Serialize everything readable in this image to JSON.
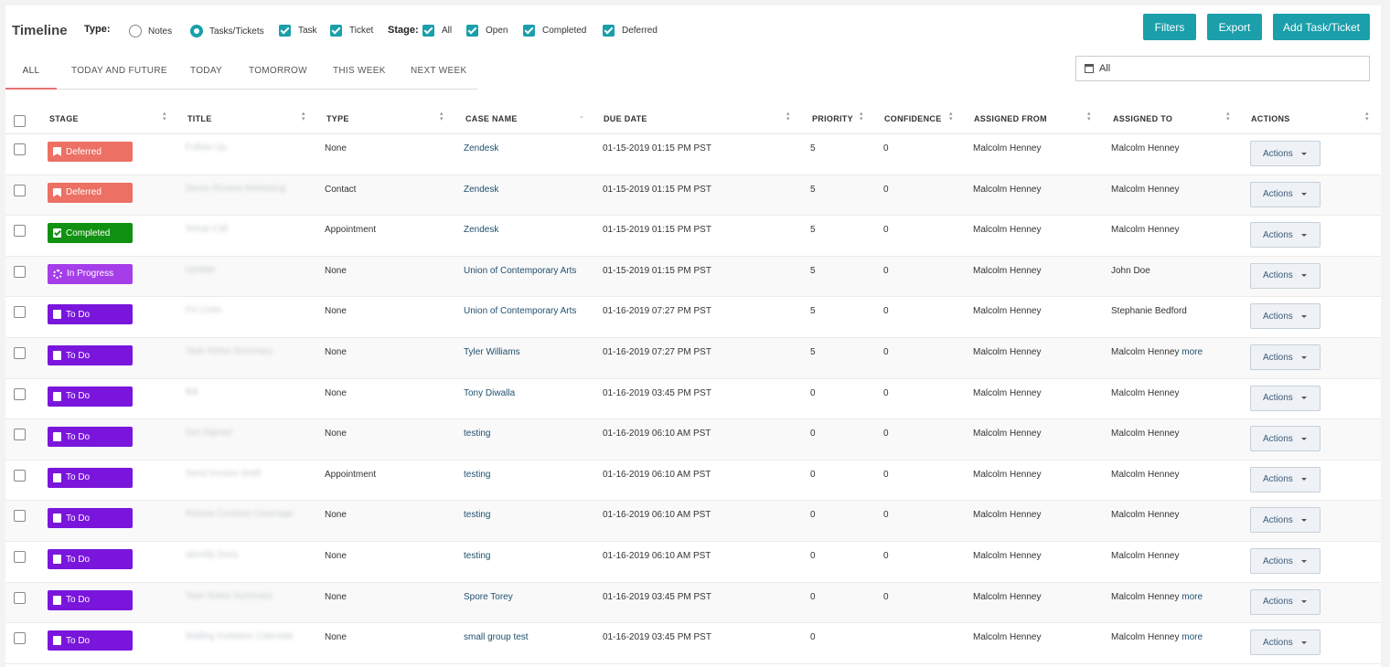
{
  "header": {
    "title": "Timeline",
    "type_label": "Type:",
    "stage_label": "Stage:",
    "type_options": [
      {
        "label": "Notes",
        "checked": false
      },
      {
        "label": "Tasks/Tickets",
        "checked": true
      }
    ],
    "type_checks": [
      {
        "label": "Task",
        "checked": true
      },
      {
        "label": "Ticket",
        "checked": true
      }
    ],
    "stage_checks": [
      {
        "label": "All",
        "checked": true
      },
      {
        "label": "Open",
        "checked": true
      },
      {
        "label": "Completed",
        "checked": true
      },
      {
        "label": "Deferred",
        "checked": true
      }
    ],
    "buttons": {
      "filters": "Filters",
      "export": "Export",
      "add": "Add Task/Ticket"
    },
    "accent_color": "#1a9fab"
  },
  "tabs": [
    {
      "label": "ALL",
      "active": true
    },
    {
      "label": "TODAY AND FUTURE",
      "active": false
    },
    {
      "label": "TODAY",
      "active": false
    },
    {
      "label": "TOMORROW",
      "active": false
    },
    {
      "label": "THIS WEEK",
      "active": false
    },
    {
      "label": "NEXT WEEK",
      "active": false
    }
  ],
  "date_filter": {
    "value": "All",
    "icon": "calendar-icon"
  },
  "table": {
    "columns": [
      "STAGE",
      "TITLE",
      "TYPE",
      "CASE NAME",
      "DUE DATE",
      "PRIORITY",
      "CONFIDENCE",
      "ASSIGNED FROM",
      "ASSIGNED TO",
      "ACTIONS"
    ],
    "stage_colors": {
      "Deferred": "#ec7063",
      "Completed": "#119111",
      "In Progress": "#a53ee8",
      "To Do": "#7a16dc"
    },
    "actions_label": "Actions",
    "more_label": "more",
    "rows": [
      {
        "stage": "Deferred",
        "title": "Follow Up",
        "type": "None",
        "case": "Zendesk",
        "due": "01-15-2019 01:15 PM PST",
        "priority": "5",
        "confidence": "0",
        "from": "Malcolm  Henney",
        "to": "Malcolm  Henney",
        "more": false
      },
      {
        "stage": "Deferred",
        "title": "Demo Review Marketing",
        "type": "Contact",
        "case": "Zendesk",
        "due": "01-15-2019 01:15 PM PST",
        "priority": "5",
        "confidence": "0",
        "from": "Malcolm  Henney",
        "to": "Malcolm  Henney",
        "more": false
      },
      {
        "stage": "Completed",
        "title": "Setup Call",
        "type": "Appointment",
        "case": "Zendesk",
        "due": "01-15-2019 01:15 PM PST",
        "priority": "5",
        "confidence": "0",
        "from": "Malcolm  Henney",
        "to": "Malcolm  Henney",
        "more": false
      },
      {
        "stage": "In Progress",
        "title": "Update",
        "type": "None",
        "case": "Union of Contemporary Arts",
        "due": "01-15-2019 01:15 PM PST",
        "priority": "5",
        "confidence": "0",
        "from": "Malcolm  Henney",
        "to": "John  Doe",
        "more": false
      },
      {
        "stage": "To Do",
        "title": "Fix Links",
        "type": "None",
        "case": "Union of Contemporary Arts",
        "due": "01-16-2019 07:27 PM PST",
        "priority": "5",
        "confidence": "0",
        "from": "Malcolm  Henney",
        "to": "Stephanie  Bedford",
        "more": false
      },
      {
        "stage": "To Do",
        "title": "Task Notes Summary",
        "type": "None",
        "case": "Tyler Williams",
        "due": "01-16-2019 07:27 PM PST",
        "priority": "5",
        "confidence": "0",
        "from": "Malcolm  Henney",
        "to": "Malcolm  Henney",
        "more": true
      },
      {
        "stage": "To Do",
        "title": "Bill",
        "type": "None",
        "case": "Tony  Diwalla",
        "due": "01-16-2019 03:45 PM PST",
        "priority": "0",
        "confidence": "0",
        "from": "Malcolm  Henney",
        "to": "Malcolm  Henney",
        "more": false
      },
      {
        "stage": "To Do",
        "title": "Get Signed",
        "type": "None",
        "case": "testing",
        "due": "01-16-2019 06:10 AM PST",
        "priority": "0",
        "confidence": "0",
        "from": "Malcolm  Henney",
        "to": "Malcolm  Henney",
        "more": false
      },
      {
        "stage": "To Do",
        "title": "Send Invoice Draft",
        "type": "Appointment",
        "case": "testing",
        "due": "01-16-2019 06:10 AM PST",
        "priority": "0",
        "confidence": "0",
        "from": "Malcolm  Henney",
        "to": "Malcolm  Henney",
        "more": false
      },
      {
        "stage": "To Do",
        "title": "Renew Contract Coverage",
        "type": "None",
        "case": "testing",
        "due": "01-16-2019 06:10 AM PST",
        "priority": "0",
        "confidence": "0",
        "from": "Malcolm  Henney",
        "to": "Malcolm  Henney",
        "more": false
      },
      {
        "stage": "To Do",
        "title": "Identify Docs",
        "type": "None",
        "case": "testing",
        "due": "01-16-2019 06:10 AM PST",
        "priority": "0",
        "confidence": "0",
        "from": "Malcolm  Henney",
        "to": "Malcolm  Henney",
        "more": false
      },
      {
        "stage": "To Do",
        "title": "Task Notes Summary",
        "type": "None",
        "case": "Spore  Torey",
        "due": "01-16-2019 03:45 PM PST",
        "priority": "0",
        "confidence": "0",
        "from": "Malcolm  Henney",
        "to": "Malcolm  Henney",
        "more": true
      },
      {
        "stage": "To Do",
        "title": "Mailing Invitation Calendar",
        "type": "None",
        "case": "small group test",
        "due": "01-16-2019 03:45 PM PST",
        "priority": "0",
        "confidence": "",
        "from": "Malcolm  Henney",
        "to": "Malcolm  Henney",
        "more": true
      }
    ]
  }
}
